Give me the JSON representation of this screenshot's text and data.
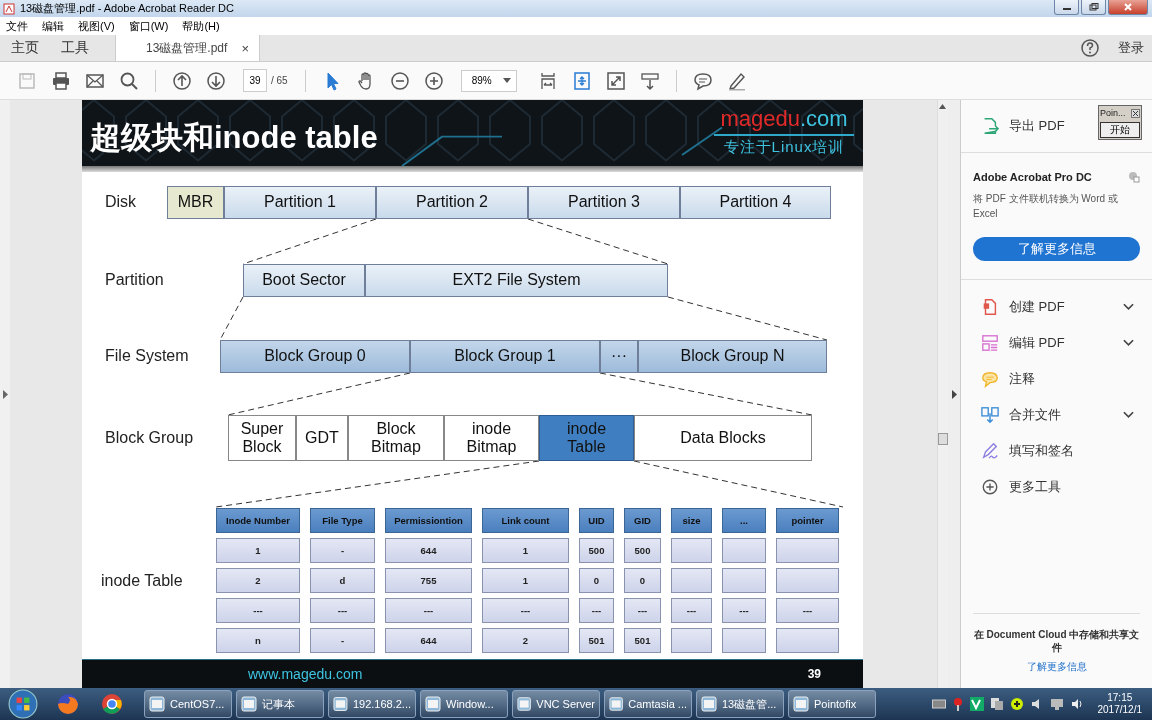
{
  "window": {
    "title": "13磁盘管理.pdf - Adobe Acrobat Reader DC"
  },
  "menu": [
    "文件",
    "编辑",
    "视图(V)",
    "窗口(W)",
    "帮助(H)"
  ],
  "tabs": [
    {
      "label": "主页",
      "selected": false
    },
    {
      "label": "工具",
      "selected": false
    },
    {
      "label": "13磁盘管理.pdf",
      "selected": true,
      "close": "×"
    }
  ],
  "sign_in": "登录",
  "toolbar": {
    "page": "39",
    "page_total": "/ 65",
    "zoom": "89%",
    "tools": [
      {
        "kind": "select",
        "selected": true
      },
      {
        "kind": "hand",
        "selected": false
      }
    ]
  },
  "slide": {
    "title": "超级块和inode table",
    "logo": {
      "name": "magedu",
      "suffix": ".com",
      "tagline": "专注于Linux培训"
    },
    "levels": [
      {
        "label": "Disk",
        "boxes": [
          {
            "text": "MBR",
            "kind": "beige"
          },
          {
            "text": "Partition 1",
            "kind": "light"
          },
          {
            "text": "Partition 2",
            "kind": "light"
          },
          {
            "text": "Partition 3",
            "kind": "light"
          },
          {
            "text": "Partition 4",
            "kind": "light"
          }
        ]
      },
      {
        "label": "Partition",
        "boxes": [
          {
            "text": "Boot Sector",
            "kind": "light"
          },
          {
            "text": "EXT2 File System",
            "kind": "light"
          }
        ]
      },
      {
        "label": "File System",
        "boxes": [
          {
            "text": "Block Group 0",
            "kind": "medium"
          },
          {
            "text": "Block Group 1",
            "kind": "medium"
          },
          {
            "text": "···",
            "kind": "medium"
          },
          {
            "text": "Block Group N",
            "kind": "medium"
          }
        ]
      },
      {
        "label": "Block Group",
        "boxes": [
          {
            "text": "Super Block",
            "kind": "white"
          },
          {
            "text": "GDT",
            "kind": "white"
          },
          {
            "text": "Block Bitmap",
            "kind": "white"
          },
          {
            "text": "inode Bitmap",
            "kind": "white"
          },
          {
            "text": "inode Table",
            "kind": "highlight"
          },
          {
            "text": "Data Blocks",
            "kind": "white"
          }
        ]
      }
    ],
    "table_label": "inode Table",
    "table": {
      "columns": [
        "Inode Number",
        "File Type",
        "Permissiontion",
        "Link count",
        "UID",
        "GID",
        "size",
        "...",
        "pointer"
      ],
      "rows": [
        [
          "1",
          "-",
          "644",
          "1",
          "500",
          "500",
          null,
          null,
          null
        ],
        [
          "2",
          "d",
          "755",
          "1",
          "0",
          "0",
          null,
          null,
          null
        ],
        [
          "---",
          "---",
          "---",
          "---",
          "---",
          "---",
          "---",
          "---",
          "---"
        ],
        [
          "n",
          "-",
          "644",
          "2",
          "501",
          "501",
          null,
          null,
          null
        ]
      ]
    },
    "footer_url": "www.magedu.com",
    "page_number": "39"
  },
  "panel": {
    "export": "导出 PDF",
    "promo": {
      "title": "Adobe Acrobat Pro DC",
      "text": "将 PDF 文件联机转换为 Word 或 Excel",
      "button": "了解更多信息"
    },
    "tools": [
      {
        "label": "创建 PDF",
        "kind": "create",
        "has_menu": true
      },
      {
        "label": "编辑 PDF",
        "kind": "edit",
        "has_menu": true
      },
      {
        "label": "注释",
        "kind": "comment",
        "has_menu": false
      },
      {
        "label": "合并文件",
        "kind": "combine",
        "has_menu": true
      },
      {
        "label": "填写和签名",
        "kind": "sign",
        "has_menu": false
      },
      {
        "label": "更多工具",
        "kind": "more",
        "has_menu": false
      }
    ],
    "cloud_text": "在 Document Cloud 中存储和共享文件",
    "cloud_link": "了解更多信息"
  },
  "pointofix": {
    "title": "Poin...",
    "button": "开始"
  },
  "taskbar": {
    "items": [
      "CentOS7...",
      "记事本",
      "192.168.2...",
      "Window...",
      "VNC Server",
      "Camtasia ...",
      "13磁盘管...",
      "Pointofix"
    ],
    "time": "17:15",
    "date": "2017/12/1"
  }
}
